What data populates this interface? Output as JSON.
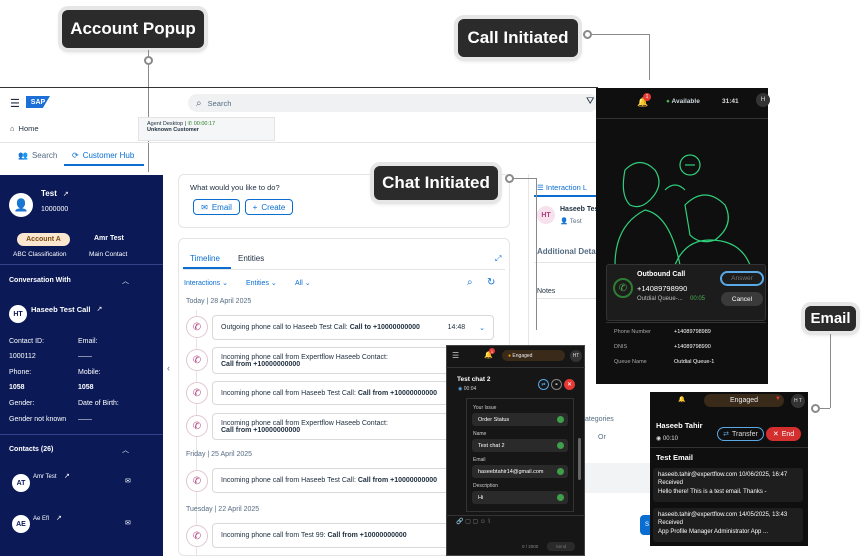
{
  "callouts": {
    "account": "Account Popup",
    "call": "Call Initiated",
    "chat": "Chat Initiated",
    "email": "Email"
  },
  "topbar": {
    "search_placeholder": "Search"
  },
  "nav": {
    "home": "Home",
    "search": "Search",
    "customer_hub": "Customer Hub"
  },
  "agent": {
    "label": "Agent Desktop |",
    "timer": "00:00:17",
    "customer": "Unknown Customer"
  },
  "account": {
    "name": "Test",
    "id": "1000000",
    "btn_a": "Account A",
    "btn_b": "Amr Test",
    "label_a": "ABC Classification",
    "label_b": "Main Contact"
  },
  "conversation": {
    "heading": "Conversation With",
    "initials": "HT",
    "name": "Haseeb Test Call",
    "contact_id_label": "Contact ID:",
    "contact_id": "1000112",
    "email_label": "Email:",
    "email": "——",
    "phone_label": "Phone:",
    "phone": "1058",
    "mobile_label": "Mobile:",
    "mobile": "1058",
    "gender_label": "Gender:",
    "gender": "Gender not known",
    "dob_label": "Date of Birth:",
    "dob": "——"
  },
  "contacts": {
    "heading": "Contacts (26)",
    "items": [
      {
        "initials": "AT",
        "name": "Amr Test"
      },
      {
        "initials": "AE",
        "name": "Ae Efl"
      }
    ]
  },
  "main": {
    "question": "What would you like to do?",
    "email_btn": "Email",
    "create_btn": "Create",
    "tab_timeline": "Timeline",
    "tab_entities": "Entities",
    "filter_interactions": "Interactions",
    "filter_entities": "Entities",
    "filter_all": "All"
  },
  "timeline": {
    "date1": "Today | 28 April 2025",
    "c1": "Outgoing phone call to Haseeb Test Call: ",
    "c1b": "Call to +10000000000",
    "c1t": "14:48",
    "c2": "Incoming phone call from Expertflow Haseeb Contact:",
    "c2b": "Call from +10000000000",
    "c3": "Incoming phone call from Haseeb Test Call: ",
    "c3b": "Call from +10000000000",
    "c4": "Incoming phone call from Expertflow Haseeb Contact:",
    "c4b": "Call from +10000000000",
    "date2": "Friday | 25 April 2025",
    "c5": "Incoming phone call from Haseeb Test Call: ",
    "c5b": "Call from +10000000000",
    "date3": "Tuesday | 22 April 2025",
    "c6": "Incoming phone call from Test 99: ",
    "c6b": "Call from +10000000000"
  },
  "right": {
    "interaction": "Interaction L",
    "person": "Haseeb Tes",
    "person_sub": "Test",
    "initials": "HT",
    "additional": "Additional Detai",
    "notes": "Notes",
    "categories": "ategories",
    "or": "Or"
  },
  "call": {
    "badge": "1",
    "status": "Available",
    "time": "31:41",
    "avatar": "H",
    "title": "Outbound Call",
    "number": "+14089798990",
    "queue": "Outdial Queue-...",
    "timer": "00:05",
    "answer": "Answer",
    "cancel": "Cancel",
    "pn_label": "Phone Number",
    "pn": "+14089798989",
    "dnis_label": "DNIS",
    "dnis": "+14089798990",
    "q_label": "Queue Name",
    "q": "Outdial Queue-1"
  },
  "chat": {
    "badge": "1",
    "status": "Engaged",
    "avatar": "HT",
    "title": "Test chat 2",
    "timer": "00:04",
    "f1l": "Your Issue",
    "f1": "Order Status",
    "f2l": "Name",
    "f2": "Test chat 2",
    "f3l": "Email",
    "f3": "haseebtahir14@gmail.com",
    "f4l": "Description",
    "f4": "Hi",
    "count": "0 / 2000",
    "send": "Send"
  },
  "email": {
    "status": "Engaged",
    "avatar": "H T",
    "name": "Haseeb Tahir",
    "timer": "00:10",
    "transfer": "Transfer",
    "end": "End",
    "subject": "Test Email",
    "m1from": "haseeb.tahir@expertflow.com",
    "m1date": "10/06/2025, 16:47",
    "m1status": "Received",
    "m1body": "Hello there! This is a test email. Thanks -",
    "m2from": "haseeb.tahir@expertflow.com",
    "m2date": "14/05/2025, 13:43",
    "m2status": "Received",
    "m2body": "App Profile Manager Administrator App ..."
  }
}
